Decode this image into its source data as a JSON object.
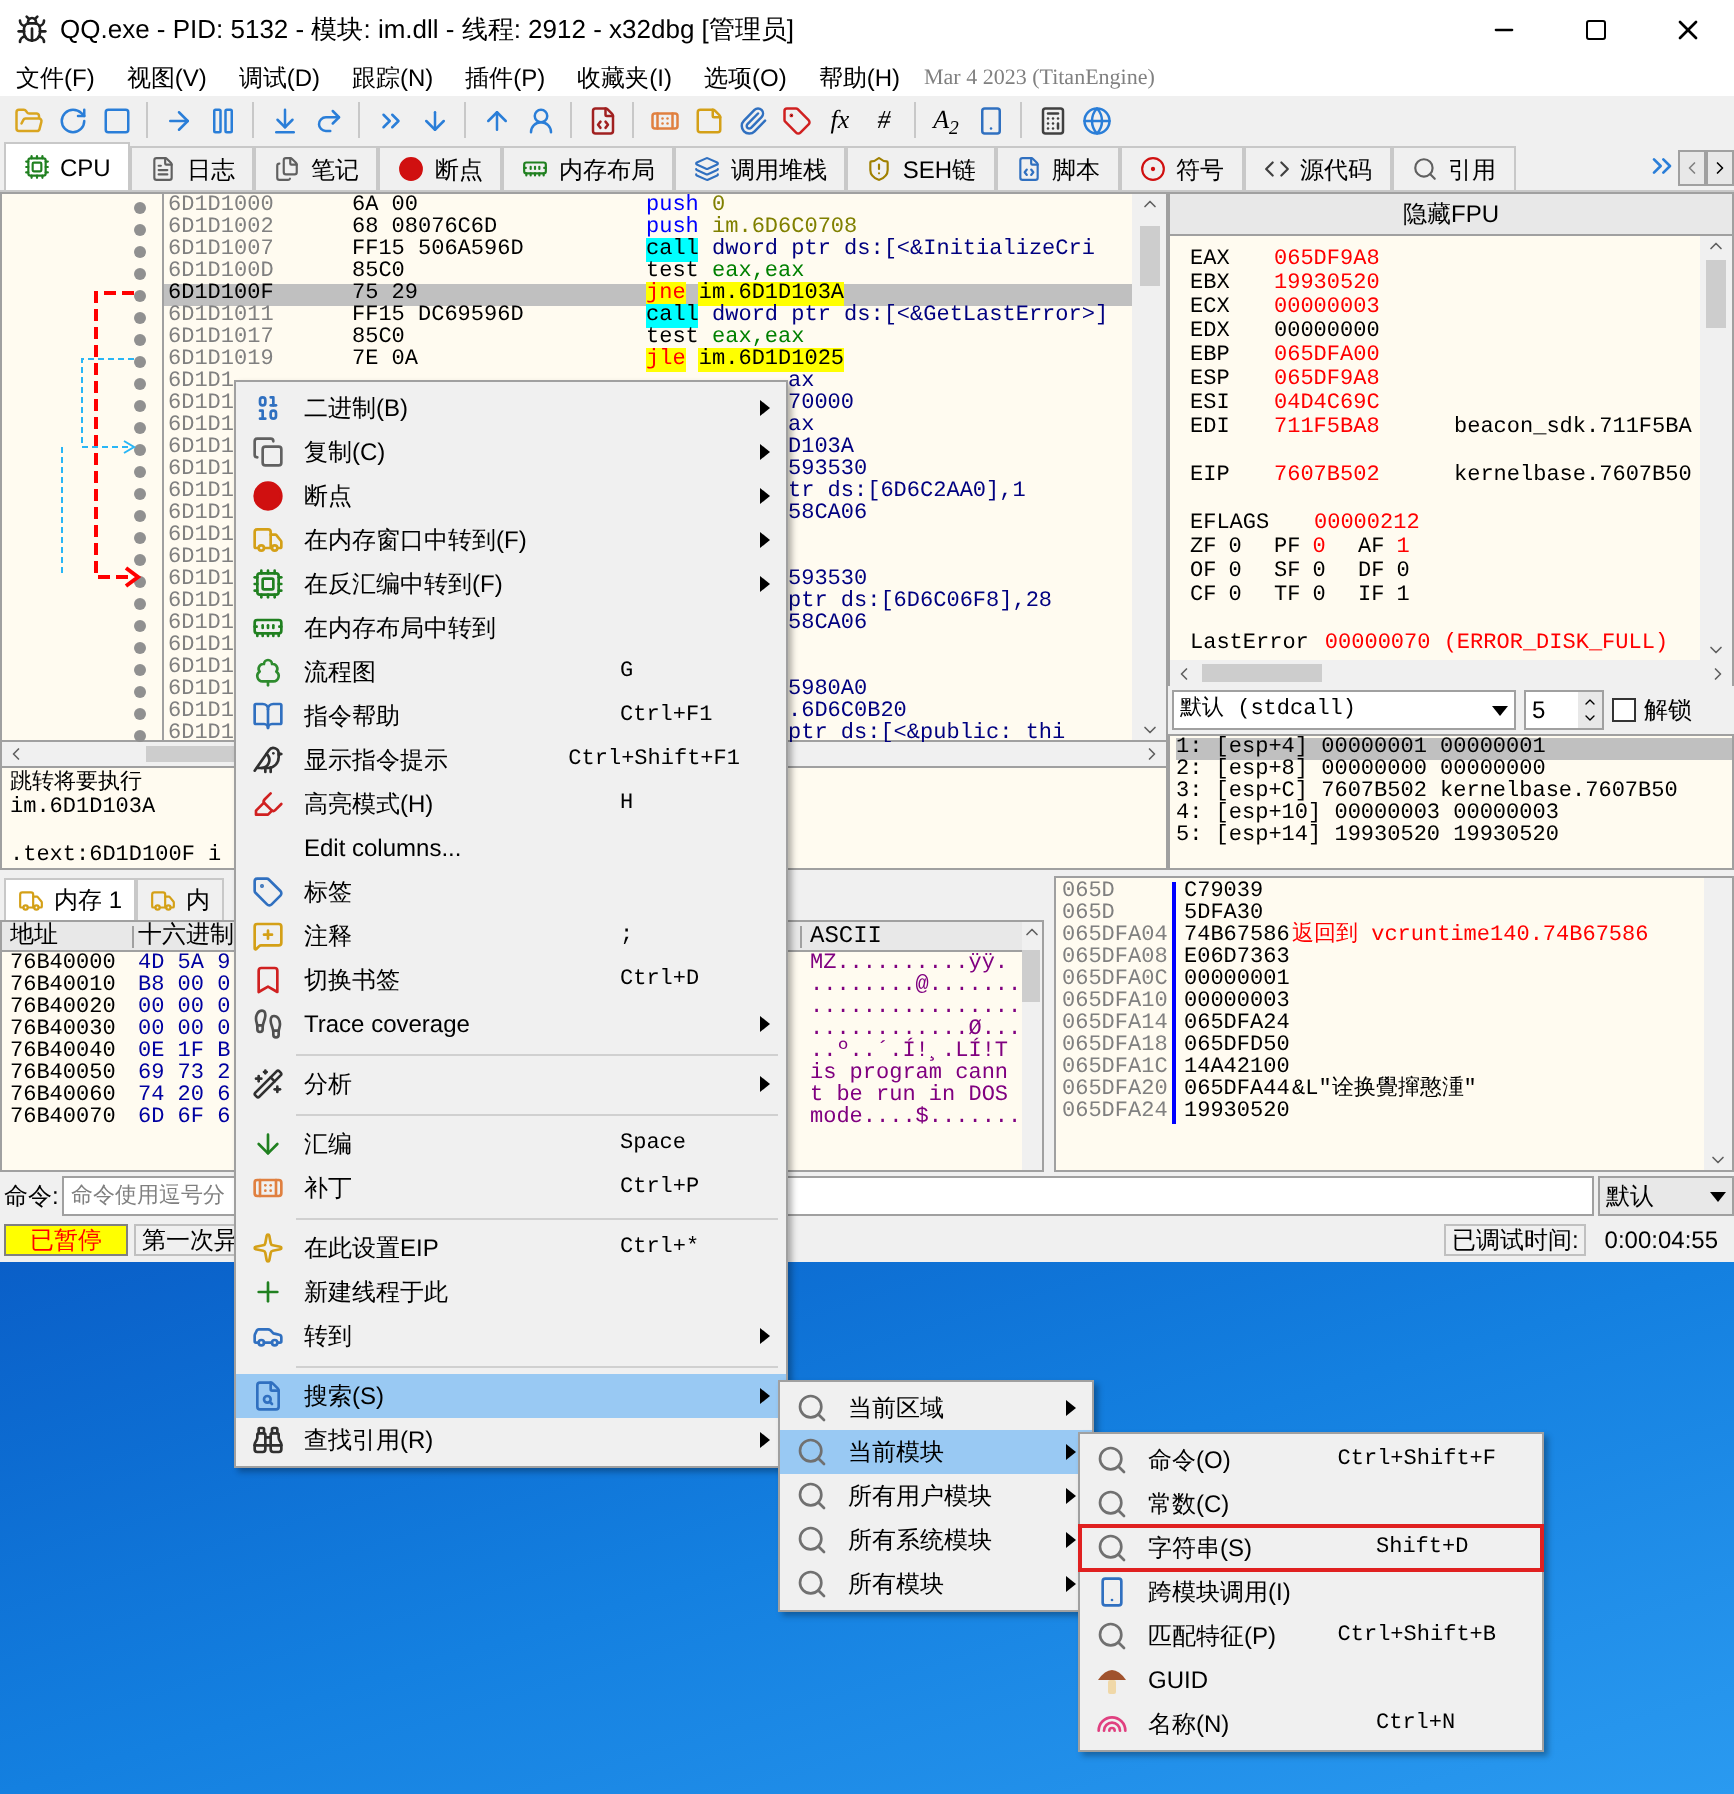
{
  "window": {
    "title": "QQ.exe - PID: 5132 - 模块: im.dll - 线程: 2912 - x32dbg [管理员]"
  },
  "menu_bar": {
    "items": [
      "文件(F)",
      "视图(V)",
      "调试(D)",
      "跟踪(N)",
      "插件(P)",
      "收藏夹(I)",
      "选项(O)",
      "帮助(H)"
    ],
    "build_info": "Mar 4 2023 (TitanEngine)"
  },
  "toolbar": [
    {
      "kind": "icon"
    },
    {
      "kind": "icon"
    },
    {
      "kind": "icon"
    },
    {
      "kind": "separator"
    },
    {
      "kind": "icon"
    },
    {
      "kind": "icon"
    },
    {
      "kind": "separator"
    },
    {
      "kind": "icon"
    },
    {
      "kind": "icon"
    },
    {
      "kind": "separator"
    },
    {
      "kind": "icon"
    },
    {
      "kind": "icon"
    },
    {
      "kind": "separator"
    },
    {
      "kind": "icon"
    },
    {
      "kind": "icon"
    },
    {
      "kind": "separator"
    },
    {
      "kind": "icon"
    },
    {
      "kind": "separator"
    },
    {
      "kind": "icon"
    },
    {
      "kind": "icon"
    },
    {
      "kind": "icon"
    },
    {
      "kind": "icon"
    },
    {
      "kind": "text",
      "label": "fx"
    },
    {
      "kind": "text",
      "label": "#"
    },
    {
      "kind": "separator"
    },
    {
      "kind": "text",
      "label": "A$_{2}$"
    },
    {
      "kind": "icon"
    },
    {
      "kind": "separator"
    },
    {
      "kind": "icon"
    },
    {
      "kind": "icon"
    }
  ],
  "tabs": [
    {
      "label": "CPU",
      "selected": true
    },
    {
      "label": "日志",
      "selected": false
    },
    {
      "label": "笔记",
      "selected": false
    },
    {
      "label": "断点",
      "selected": false
    },
    {
      "label": "内存布局",
      "selected": false
    },
    {
      "label": "调用堆栈",
      "selected": false
    },
    {
      "label": "SEH链",
      "selected": false
    },
    {
      "label": "脚本",
      "selected": false
    },
    {
      "label": "符号",
      "selected": false
    },
    {
      "label": "源代码",
      "selected": false
    },
    {
      "label": "引用",
      "selected": false
    }
  ],
  "disassembly": {
    "rows": [
      {
        "address": "6D1D1000",
        "bytes": "6A 00",
        "mnemonic": "push",
        "operand": "0",
        "kind": "push",
        "selected": false
      },
      {
        "address": "6D1D1002",
        "bytes": "68 08076C6D",
        "mnemonic": "push",
        "operand": "im.6D6C0708",
        "kind": "push",
        "selected": false
      },
      {
        "address": "6D1D1007",
        "bytes": "FF15 506A596D",
        "mnemonic": "call",
        "operand": "dword ptr ds:[<&InitializeCri",
        "kind": "call",
        "selected": false
      },
      {
        "address": "6D1D100D",
        "bytes": "85C0",
        "mnemonic": "test",
        "operand": "eax,eax",
        "kind": "test",
        "selected": false
      },
      {
        "address": "6D1D100F",
        "bytes": "75 29",
        "mnemonic": "jne",
        "operand": "im.6D1D103A",
        "kind": "jump",
        "selected": true
      },
      {
        "address": "6D1D1011",
        "bytes": "FF15 DC69596D",
        "mnemonic": "call",
        "operand": "dword ptr ds:[<&GetLastError>]",
        "kind": "call",
        "selected": false
      },
      {
        "address": "6D1D1017",
        "bytes": "85C0",
        "mnemonic": "test",
        "operand": "eax,eax",
        "kind": "test",
        "selected": false
      },
      {
        "address": "6D1D1019",
        "bytes": "7E 0A",
        "mnemonic": "jle",
        "operand": "im.6D1D1025",
        "kind": "jump",
        "selected": false
      }
    ],
    "covered_rows": [
      {
        "address": "6D1D1",
        "tail": "ax"
      },
      {
        "address": "6D1D1",
        "tail": "70000"
      },
      {
        "address": "6D1D1",
        "tail": "ax"
      },
      {
        "address": "6D1D1",
        "tail": "D103A"
      },
      {
        "address": "6D1D1",
        "tail": "593530"
      },
      {
        "address": "6D1D1",
        "tail": "tr ds:[6D6C2AA0],1"
      },
      {
        "address": "6D1D1",
        "tail": "58CA06"
      },
      {
        "address": "6D1D1"
      },
      {
        "address": "6D1D1"
      },
      {
        "address": "6D1D1",
        "tail": "593530"
      },
      {
        "address": "6D1D1",
        "tail": "ptr ds:[6D6C06F8],28"
      },
      {
        "address": "6D1D1",
        "tail": "58CA06"
      },
      {
        "address": "6D1D1"
      },
      {
        "address": "6D1D1"
      },
      {
        "address": "6D1D1",
        "tail": "5980A0"
      },
      {
        "address": "6D1D1",
        "tail": ".6D6C0B20"
      },
      {
        "address": "6D1D1",
        "tail": "ptr ds:[<&public:   thi"
      }
    ]
  },
  "info_pane": {
    "lines": [
      "跳转将要执行",
      "im.6D1D103A",
      ".text:6D1D100F i"
    ]
  },
  "registers": {
    "fpu_button": "隐藏FPU",
    "groups": [
      [
        {
          "name": "EAX",
          "value": "065DF9A8",
          "changed": true
        },
        {
          "name": "EBX",
          "value": "19930520",
          "changed": true
        },
        {
          "name": "ECX",
          "value": "00000003",
          "changed": true
        },
        {
          "name": "EDX",
          "value": "00000000",
          "changed": false
        },
        {
          "name": "EBP",
          "value": "065DFA00",
          "changed": true
        },
        {
          "name": "ESP",
          "value": "065DF9A8",
          "changed": true
        },
        {
          "name": "ESI",
          "value": "04D4C69C",
          "changed": true
        },
        {
          "name": "EDI",
          "value": "711F5BA8",
          "changed": true,
          "comment": "beacon_sdk.711F5BA"
        }
      ],
      [
        {
          "name": "EIP",
          "value": "7607B502",
          "changed": true,
          "comment": "kernelbase.7607B50"
        }
      ],
      [
        {
          "name": "EFLAGS",
          "value": "00000212",
          "changed": true
        }
      ]
    ],
    "flags": [
      [
        {
          "name": "ZF",
          "value": "0",
          "changed": false
        },
        {
          "name": "PF",
          "value": "0",
          "changed": true
        },
        {
          "name": "AF",
          "value": "1",
          "changed": true
        }
      ],
      [
        {
          "name": "OF",
          "value": "0",
          "changed": false
        },
        {
          "name": "SF",
          "value": "0",
          "changed": false
        },
        {
          "name": "DF",
          "value": "0",
          "changed": false
        }
      ],
      [
        {
          "name": "CF",
          "value": "0",
          "changed": false
        },
        {
          "name": "TF",
          "value": "0",
          "changed": false
        },
        {
          "name": "IF",
          "value": "1",
          "changed": false
        }
      ]
    ],
    "last_error": {
      "name": "LastError",
      "value": "00000070 (ERROR_DISK_FULL)"
    }
  },
  "call_convention": {
    "value": "默认 (stdcall)",
    "count": "5",
    "unlock": {
      "label": "解锁",
      "checked": false
    }
  },
  "arguments": [
    {
      "text": "1: [esp+4] 00000001 00000001",
      "selected": true
    },
    {
      "text": "2: [esp+8] 00000000 00000000",
      "selected": false
    },
    {
      "text": "3: [esp+C] 7607B502 kernelbase.7607B50",
      "selected": false
    },
    {
      "text": "4: [esp+10] 00000003 00000003",
      "selected": false
    },
    {
      "text": "5: [esp+14] 19930520 19930520",
      "selected": false
    }
  ],
  "dump_tabs": [
    {
      "label": "内存 1",
      "selected": true
    },
    {
      "label": "内",
      "selected": false
    }
  ],
  "dump": {
    "columns": [
      "地址",
      "十六进制",
      "ASCII"
    ],
    "rows": [
      {
        "address": "76B40000",
        "hex": "4D 5A 9",
        "ascii": "MZ..........ÿÿ."
      },
      {
        "address": "76B40010",
        "hex": "B8 00 0",
        "ascii": "........@......."
      },
      {
        "address": "76B40020",
        "hex": "00 00 0",
        "ascii": "................"
      },
      {
        "address": "76B40030",
        "hex": "00 00 0",
        "ascii": "............Ø..."
      },
      {
        "address": "76B40040",
        "hex": "0E 1F B",
        "ascii": "..º..´.Í!¸.LÍ!T"
      },
      {
        "address": "76B40050",
        "hex": "69 73 2",
        "ascii": "is program cann"
      },
      {
        "address": "76B40060",
        "hex": "74 20 6",
        "ascii": "t be run in DOS"
      },
      {
        "address": "76B40070",
        "hex": "6D 6F 6",
        "ascii": "mode....$......."
      }
    ]
  },
  "stack": [
    {
      "address": "065D",
      "value": "C79039"
    },
    {
      "address": "065D",
      "value": "5DFA30"
    },
    {
      "address": "065DFA04",
      "value": "74B67586",
      "comment": "返回到 vcruntime140.74B67586",
      "kind": "return"
    },
    {
      "address": "065DFA08",
      "value": "E06D7363"
    },
    {
      "address": "065DFA0C",
      "value": "00000001"
    },
    {
      "address": "065DFA10",
      "value": "00000003"
    },
    {
      "address": "065DFA14",
      "value": "065DFA24"
    },
    {
      "address": "065DFA18",
      "value": "065DFD50"
    },
    {
      "address": "065DFA1C",
      "value": "14A42100"
    },
    {
      "address": "065DFA20",
      "value": "065DFA44",
      "comment": "&L\"诠换覺撺憨湩\"",
      "kind": "string"
    },
    {
      "address": "065DFA24",
      "value": "19930520"
    }
  ],
  "command_bar": {
    "label": "命令:",
    "placeholder": "命令使用逗号分",
    "mode": "默认"
  },
  "status_bar": {
    "state": "已暂停",
    "message": "第一次异",
    "elapsed_label": "已调试时间:",
    "elapsed": "0:00:04:55"
  },
  "context_menu": {
    "items": [
      {
        "kind": "item",
        "label": "二进制(B)",
        "submenu": true,
        "selected": false
      },
      {
        "kind": "item",
        "label": "复制(C)",
        "submenu": true,
        "selected": false
      },
      {
        "kind": "item",
        "label": "断点",
        "submenu": true,
        "selected": false
      },
      {
        "kind": "item",
        "label": "在内存窗口中转到(F)",
        "submenu": true,
        "selected": false
      },
      {
        "kind": "item",
        "label": "在反汇编中转到(F)",
        "submenu": true,
        "selected": false
      },
      {
        "kind": "item",
        "label": "在内存布局中转到",
        "submenu": false,
        "selected": false
      },
      {
        "kind": "item",
        "label": "流程图",
        "shortcut": "G",
        "submenu": false,
        "selected": false
      },
      {
        "kind": "item",
        "label": "指令帮助",
        "shortcut": "Ctrl+F1",
        "submenu": false,
        "selected": false
      },
      {
        "kind": "item",
        "label": "显示指令提示",
        "shortcut": "Ctrl+Shift+F1",
        "submenu": false,
        "selected": false
      },
      {
        "kind": "item",
        "label": "高亮模式(H)",
        "shortcut": "H",
        "submenu": false,
        "selected": false
      },
      {
        "kind": "item",
        "label": "Edit columns...",
        "submenu": false,
        "selected": false
      },
      {
        "kind": "item",
        "label": "标签",
        "submenu": false,
        "selected": false
      },
      {
        "kind": "item",
        "label": "注释",
        "shortcut": ";",
        "submenu": false,
        "selected": false
      },
      {
        "kind": "item",
        "label": "切换书签",
        "shortcut": "Ctrl+D",
        "submenu": false,
        "selected": false
      },
      {
        "kind": "item",
        "label": "Trace coverage",
        "submenu": true,
        "selected": false
      },
      {
        "kind": "separator"
      },
      {
        "kind": "item",
        "label": "分析",
        "submenu": true,
        "selected": false
      },
      {
        "kind": "separator"
      },
      {
        "kind": "item",
        "label": "汇编",
        "shortcut": "Space",
        "submenu": false,
        "selected": false
      },
      {
        "kind": "item",
        "label": "补丁",
        "shortcut": "Ctrl+P",
        "submenu": false,
        "selected": false
      },
      {
        "kind": "separator"
      },
      {
        "kind": "item",
        "label": "在此设置EIP",
        "shortcut": "Ctrl+*",
        "submenu": false,
        "selected": false
      },
      {
        "kind": "item",
        "label": "新建线程于此",
        "submenu": false,
        "selected": false
      },
      {
        "kind": "item",
        "label": "转到",
        "submenu": true,
        "selected": false
      },
      {
        "kind": "separator"
      },
      {
        "kind": "item",
        "label": "搜索(S)",
        "submenu": true,
        "selected": true
      },
      {
        "kind": "item",
        "label": "查找引用(R)",
        "submenu": true,
        "selected": false
      }
    ]
  },
  "search_submenu": {
    "items": [
      {
        "kind": "item",
        "label": "当前区域",
        "submenu": true,
        "selected": false
      },
      {
        "kind": "item",
        "label": "当前模块",
        "submenu": true,
        "selected": true
      },
      {
        "kind": "item",
        "label": "所有用户模块",
        "submenu": true,
        "selected": false
      },
      {
        "kind": "item",
        "label": "所有系统模块",
        "submenu": true,
        "selected": false
      },
      {
        "kind": "item",
        "label": "所有模块",
        "submenu": true,
        "selected": false
      }
    ]
  },
  "module_submenu": {
    "items": [
      {
        "kind": "item",
        "label": "命令(O)",
        "shortcut": "Ctrl+Shift+F",
        "submenu": false,
        "selected": false,
        "highlighted": false
      },
      {
        "kind": "item",
        "label": "常数(C)",
        "submenu": false,
        "selected": false,
        "highlighted": false
      },
      {
        "kind": "item",
        "label": "字符串(S)",
        "shortcut": "Shift+D",
        "submenu": false,
        "selected": false,
        "highlighted": true
      },
      {
        "kind": "item",
        "label": "跨模块调用(I)",
        "submenu": false,
        "selected": false,
        "highlighted": false
      },
      {
        "kind": "item",
        "label": "匹配特征(P)",
        "shortcut": "Ctrl+Shift+B",
        "submenu": false,
        "selected": false,
        "highlighted": false
      },
      {
        "kind": "item",
        "label": "GUID",
        "submenu": false,
        "selected": false,
        "highlighted": false
      },
      {
        "kind": "item",
        "label": "名称(N)",
        "shortcut": "Ctrl+N",
        "submenu": false,
        "selected": false,
        "highlighted": false
      }
    ]
  }
}
